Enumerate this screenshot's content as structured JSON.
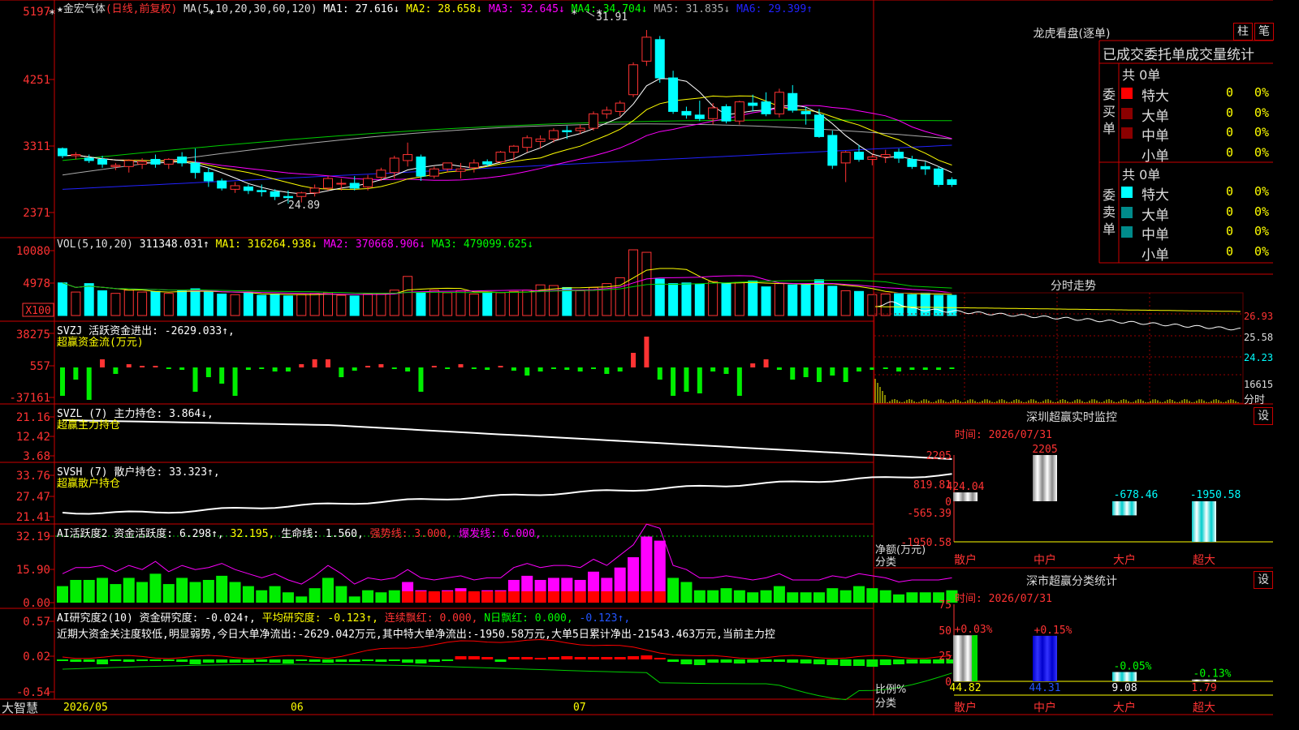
{
  "stock": {
    "name": "★金宏气体",
    "mode": "(日线,前复权)",
    "ma_label": "MA(5,10,20,30,60,120)",
    "ma_values": [
      {
        "t": "MA1: 27.616↓",
        "c": "#ffffff"
      },
      {
        "t": "MA2: 28.658↓",
        "c": "#ffff00"
      },
      {
        "t": "MA3: 32.645↓",
        "c": "#ff00ff"
      },
      {
        "t": "MA4: 34.704↓",
        "c": "#00ff00"
      },
      {
        "t": "MA5: 31.835↓",
        "c": "#aaaaaa"
      },
      {
        "t": "MA6: 29.399↑",
        "c": "#2222ff"
      }
    ],
    "high_label": "31.91",
    "low_label": "24.89",
    "price_ticks": [
      "5197",
      "4251",
      "3311",
      "2371"
    ]
  },
  "vol": {
    "label": "VOL(5,10,20)",
    "value": "311348.031↑",
    "ma": [
      {
        "t": "MA1: 316264.938↓",
        "c": "#ffff00"
      },
      {
        "t": "MA2: 370668.906↓",
        "c": "#ff00ff"
      },
      {
        "t": "MA3: 479099.625↓",
        "c": "#00ff00"
      }
    ],
    "ticks": [
      "10080",
      "4978"
    ],
    "unit": "X100"
  },
  "svzj": {
    "label": "SVZJ  活跃资金进出: -2629.033↑,",
    "sub": "超赢资金流(万元)",
    "ticks": [
      "38275",
      "557",
      "-37161"
    ]
  },
  "svzl": {
    "label": "SVZL (7) 主力持仓: 3.864↓,",
    "sub": "超赢主力持仓",
    "ticks": [
      "21.16",
      "12.42",
      "3.68"
    ]
  },
  "svsh": {
    "label": "SVSH (7) 散户持仓: 33.323↑,",
    "sub": "超赢散户持仓",
    "ticks": [
      "33.76",
      "27.47",
      "21.41"
    ]
  },
  "ai1": {
    "label": "AI活跃度2 资金活跃度: 6.298↑,",
    "items": [
      {
        "t": "32.195,",
        "c": "#ffff00"
      },
      {
        "t": "生命线: 1.560,",
        "c": "#ffffff"
      },
      {
        "t": "强势线: 3.000,",
        "c": "#ff3333"
      },
      {
        "t": "爆发线: 6.000,",
        "c": "#ff00ff"
      }
    ],
    "ticks": [
      "32.19",
      "15.90",
      "0.00"
    ]
  },
  "ai2": {
    "label": "AI研究度2(10) 资金研究度: -0.024↑,",
    "items": [
      {
        "t": "平均研究度: -0.123↑,",
        "c": "#ffff00"
      },
      {
        "t": "连续飘红: 0.000,",
        "c": "#ff3333"
      },
      {
        "t": "N日飘红: 0.000,",
        "c": "#00ff00"
      },
      {
        "t": "-0.123↑,",
        "c": "#2255ff"
      }
    ],
    "comment": "近期大资金关注度较低,明显弱势,今日大单净流出:-2629.042万元,其中特大单净流出:-1950.58万元,大单5日累计净出-21543.463万元,当前主力控",
    "ticks": [
      "0.57",
      "0.02",
      "-0.54"
    ]
  },
  "dates": [
    "2026/05",
    "06",
    "07"
  ],
  "logo": "大智慧",
  "lhb": {
    "title": "龙虎看盘(逐单)",
    "btn1": "柱",
    "btn2": "笔",
    "header": "已成交委托单成交量统计",
    "buy_label": "委买单",
    "sell_label": "委卖单",
    "buy_total": "共 0单",
    "sell_total": "共 0单",
    "rows": [
      "特大",
      "大单",
      "中单",
      "小单"
    ],
    "buy_colors": [
      "#ff0000",
      "#8b0000",
      "#8b0000",
      ""
    ],
    "sell_colors": [
      "#00ffff",
      "#008b8b",
      "#008b8b",
      ""
    ],
    "count": "0",
    "pct": "0%"
  },
  "fenshi": {
    "title": "分时走势",
    "ticks": [
      "26.93",
      "25.58",
      "24.23"
    ],
    "vol": "16615",
    "unit": "分时"
  },
  "monitor": {
    "title": "深圳超赢实时监控",
    "btn": "设",
    "time": "时间: 2026/07/31",
    "ticks": [
      "2205",
      "819.81",
      "0",
      "-565.39",
      "-1950.58"
    ],
    "ylabel": "净额(万元)",
    "xlabel": "分类",
    "cats": [
      "散户",
      "中户",
      "大户",
      "超大"
    ],
    "values": [
      424.04,
      2205,
      -678.46,
      -1950.58
    ],
    "labels": [
      "424.04",
      "2205",
      "-678.46",
      "-1950.58"
    ]
  },
  "classify": {
    "title": "深市超赢分类统计",
    "btn": "设",
    "time": "时间: 2026/07/31",
    "ticks": [
      "75",
      "50",
      "25",
      "0"
    ],
    "ylabel": "比例%",
    "xlabel": "分类",
    "cats": [
      "散户",
      "中户",
      "大户",
      "超大"
    ],
    "values": [
      44.82,
      44.31,
      9.08,
      1.79
    ],
    "changes": [
      "+0.03%",
      "+0.15%",
      "-0.05%",
      "-0.13%"
    ],
    "labels": [
      "44.82",
      "44.31",
      "9.08",
      "1.79"
    ]
  },
  "chart_data": {
    "type": "candlestick",
    "title": "金宏气体 日线",
    "ohlc": [
      [
        29.5,
        29.6,
        28.7,
        28.9
      ],
      [
        28.9,
        29.2,
        28.6,
        29.0
      ],
      [
        28.7,
        29.0,
        28.3,
        28.5
      ],
      [
        28.6,
        28.9,
        27.9,
        28.2
      ],
      [
        28.0,
        28.3,
        27.7,
        28.1
      ],
      [
        28.0,
        28.6,
        27.5,
        28.5
      ],
      [
        28.2,
        28.7,
        27.8,
        28.4
      ],
      [
        28.6,
        29.0,
        27.9,
        28.2
      ],
      [
        28.2,
        28.7,
        27.8,
        28.6
      ],
      [
        28.8,
        29.2,
        28.0,
        28.3
      ],
      [
        28.3,
        29.5,
        27.0,
        27.5
      ],
      [
        27.5,
        27.9,
        26.3,
        26.8
      ],
      [
        26.8,
        27.0,
        26.0,
        26.2
      ],
      [
        26.1,
        26.7,
        25.8,
        26.4
      ],
      [
        26.3,
        26.5,
        25.7,
        26.0
      ],
      [
        26.0,
        26.5,
        25.5,
        25.9
      ],
      [
        25.9,
        26.1,
        25.2,
        25.5
      ],
      [
        25.5,
        26.0,
        24.9,
        25.4
      ],
      [
        25.5,
        25.9,
        25.0,
        25.8
      ],
      [
        25.8,
        26.5,
        25.5,
        26.2
      ],
      [
        26.2,
        27.2,
        26.0,
        27.0
      ],
      [
        26.6,
        27.0,
        26.0,
        26.6
      ],
      [
        26.6,
        27.2,
        26.0,
        26.2
      ],
      [
        26.3,
        27.3,
        26.0,
        27.0
      ],
      [
        27.1,
        27.9,
        26.8,
        27.7
      ],
      [
        27.5,
        28.9,
        27.0,
        28.7
      ],
      [
        28.5,
        30.0,
        28.0,
        29.0
      ],
      [
        28.8,
        29.0,
        26.8,
        27.2
      ],
      [
        27.2,
        28.0,
        27.0,
        27.8
      ],
      [
        27.8,
        28.3,
        27.5,
        28.3
      ],
      [
        27.6,
        28.3,
        27.0,
        27.8
      ],
      [
        27.9,
        28.6,
        27.5,
        28.3
      ],
      [
        28.4,
        28.6,
        28.0,
        28.2
      ],
      [
        28.4,
        29.3,
        28.2,
        29.2
      ],
      [
        29.2,
        29.8,
        28.5,
        29.7
      ],
      [
        29.6,
        30.6,
        29.2,
        30.4
      ],
      [
        30.1,
        30.6,
        29.5,
        30.3
      ],
      [
        30.3,
        31.2,
        30.0,
        31.0
      ],
      [
        31.0,
        31.4,
        30.3,
        30.9
      ],
      [
        31.0,
        31.5,
        30.7,
        31.2
      ],
      [
        31.2,
        32.6,
        31.0,
        32.4
      ],
      [
        32.4,
        33.0,
        32.0,
        32.7
      ],
      [
        32.6,
        33.5,
        32.2,
        33.3
      ],
      [
        34.0,
        36.7,
        33.8,
        36.5
      ],
      [
        36.8,
        39.4,
        36.4,
        38.8
      ],
      [
        38.6,
        38.9,
        35.0,
        35.4
      ],
      [
        35.4,
        36.0,
        32.4,
        32.6
      ],
      [
        32.6,
        33.0,
        32.0,
        32.3
      ],
      [
        32.3,
        33.5,
        31.8,
        32.0
      ],
      [
        32.0,
        33.3,
        31.5,
        32.9
      ],
      [
        33.0,
        33.2,
        31.6,
        31.8
      ],
      [
        31.8,
        33.5,
        31.5,
        33.4
      ],
      [
        33.3,
        34.0,
        32.6,
        33.1
      ],
      [
        33.4,
        34.2,
        32.2,
        32.4
      ],
      [
        32.4,
        34.5,
        32.1,
        34.2
      ],
      [
        34.1,
        34.8,
        32.5,
        32.7
      ],
      [
        32.6,
        33.0,
        31.5,
        32.4
      ],
      [
        32.3,
        32.8,
        30.4,
        30.5
      ],
      [
        30.6,
        31.0,
        27.8,
        28.1
      ],
      [
        28.3,
        29.3,
        26.7,
        29.2
      ],
      [
        29.2,
        29.8,
        28.4,
        28.6
      ],
      [
        28.6,
        29.0,
        28.1,
        28.8
      ],
      [
        28.8,
        29.4,
        28.3,
        29.0
      ],
      [
        29.2,
        29.5,
        28.3,
        28.7
      ],
      [
        28.6,
        28.9,
        27.8,
        28.0
      ],
      [
        28.0,
        28.4,
        27.3,
        27.8
      ],
      [
        27.8,
        28.0,
        26.3,
        26.5
      ],
      [
        26.9,
        27.1,
        26.3,
        26.5
      ]
    ],
    "volume": [
      5010,
      3600,
      4900,
      3800,
      3400,
      3900,
      3600,
      3700,
      3400,
      3800,
      4100,
      3600,
      3300,
      3200,
      3500,
      3100,
      3300,
      3000,
      3200,
      3400,
      3500,
      3100,
      3000,
      3300,
      3400,
      3900,
      6000,
      3600,
      3900,
      3500,
      3800,
      3300,
      3600,
      3500,
      3700,
      3900,
      4700,
      4600,
      4300,
      3800,
      4300,
      4900,
      5800,
      10080,
      9700,
      5600,
      4900,
      5000,
      4800,
      5200,
      4900,
      5100,
      5300,
      4400,
      4900,
      4700,
      4700,
      5500,
      4500,
      3800,
      3700,
      3200,
      3300,
      3400,
      3200,
      3500,
      3100,
      3100
    ],
    "ylim": [
      22.4,
      41.5
    ]
  }
}
